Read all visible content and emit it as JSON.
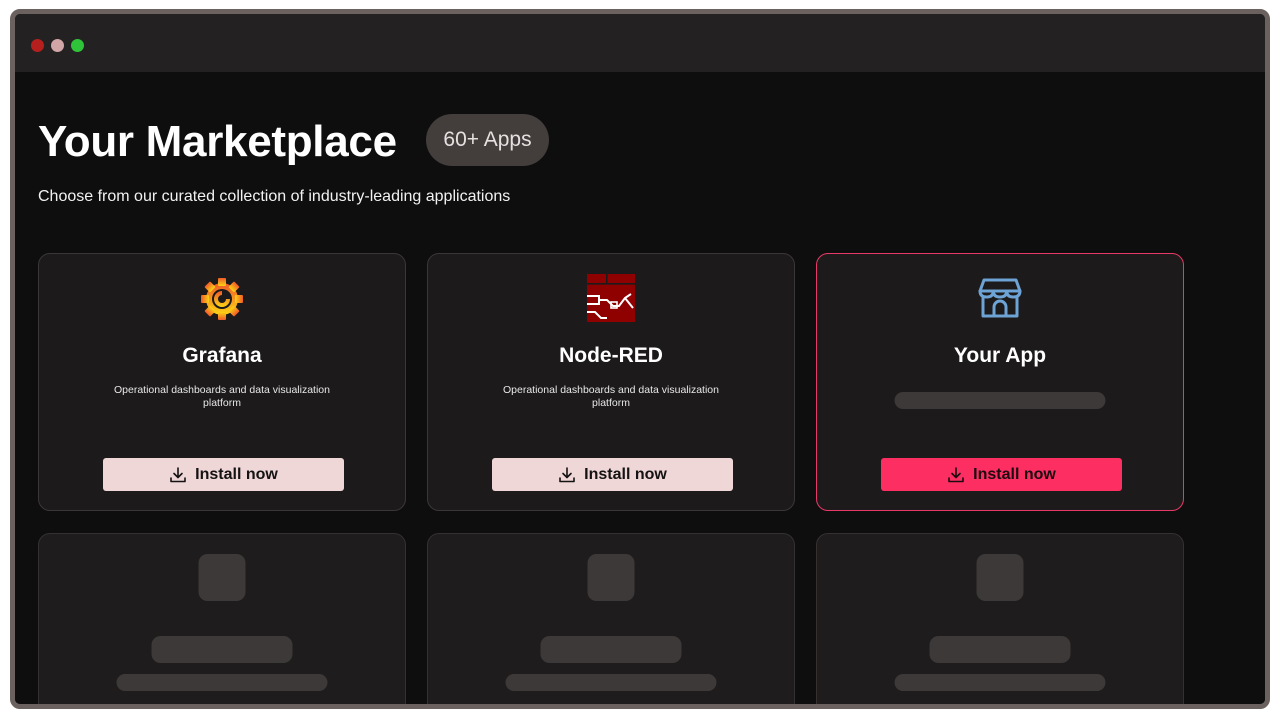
{
  "window": {
    "controls": [
      "close",
      "minimize",
      "maximize"
    ]
  },
  "page": {
    "title": "Your Marketplace",
    "badge": "60+ Apps",
    "subtitle": "Choose from our curated collection of industry-leading applications"
  },
  "apps": [
    {
      "name": "Grafana",
      "description": "Operational dashboards and data visualization platform",
      "icon": "grafana-logo-icon",
      "install_label": "Install now"
    },
    {
      "name": "Node-RED",
      "description": "Operational dashboards and data visualization platform",
      "icon": "node-red-logo-icon",
      "install_label": "Install now"
    },
    {
      "name": "Your App",
      "description": "",
      "icon": "storefront-icon",
      "install_label": "Install now",
      "featured": true
    }
  ],
  "colors": {
    "accent": "#fd2f62",
    "install_button_bg": "#efd7d8",
    "background": "#0f0e0e",
    "card": "#1c1a1a",
    "skeleton": "#3d3939",
    "badge_bg": "#433d3c"
  }
}
